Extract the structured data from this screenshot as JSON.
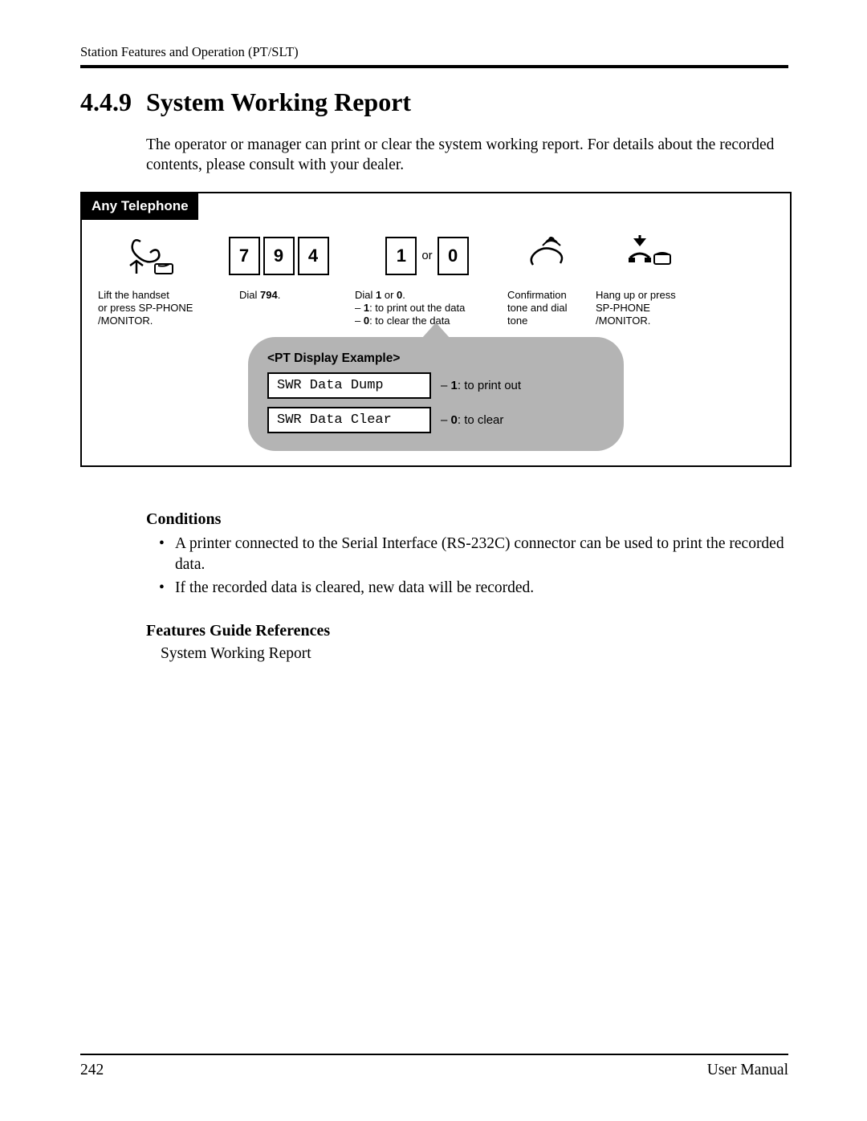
{
  "header": "Station Features and Operation (PT/SLT)",
  "section": {
    "number": "4.4.9",
    "title": "System Working Report"
  },
  "intro": "The operator or manager can print or clear the system working report. For details about the recorded contents, please consult with your dealer.",
  "diagram": {
    "tab": "Any Telephone",
    "step1": {
      "caption_l1": "Lift the handset",
      "caption_l2": "or press SP-PHONE",
      "caption_l3": "/MONITOR."
    },
    "step2": {
      "keys": [
        "7",
        "9",
        "4"
      ],
      "caption_prefix": "Dial ",
      "caption_bold": "794",
      "caption_suffix": "."
    },
    "step3": {
      "key_a": "1",
      "or": "or",
      "key_b": "0",
      "caption_l1_pre": "Dial ",
      "caption_l1_b1": "1",
      "caption_l1_mid": " or ",
      "caption_l1_b2": "0",
      "caption_l1_suf": ".",
      "caption_l2_pre": "– ",
      "caption_l2_b": "1",
      "caption_l2_suf": ": to print out the data",
      "caption_l3_pre": "– ",
      "caption_l3_b": "0",
      "caption_l3_suf": ": to clear the data"
    },
    "step4": {
      "caption_l1": "Confirmation",
      "caption_l2": "tone and dial",
      "caption_l3": "tone"
    },
    "step5": {
      "caption_l1": "Hang up or press",
      "caption_l2": "SP-PHONE",
      "caption_l3": "/MONITOR."
    },
    "pt": {
      "title": "<PT Display Example>",
      "row1_display": "SWR Data Dump",
      "row1_pre": "– ",
      "row1_b": "1",
      "row1_suf": ": to print out",
      "row2_display": "SWR Data Clear",
      "row2_pre": "– ",
      "row2_b": "0",
      "row2_suf": ": to clear"
    }
  },
  "conditions": {
    "heading": "Conditions",
    "items": [
      "A printer connected to the Serial Interface (RS-232C) connector can be used to print the recorded data.",
      "If the recorded data is cleared, new data will be recorded."
    ]
  },
  "features": {
    "heading": "Features Guide References",
    "text": "System Working Report"
  },
  "footer": {
    "page": "242",
    "title": "User Manual"
  }
}
